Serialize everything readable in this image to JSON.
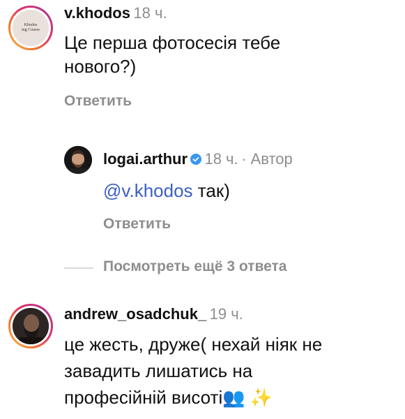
{
  "comments": [
    {
      "username": "v.khodos",
      "time": "18 ч.",
      "text": "Це перша фотосесія тебе нового?)",
      "reply_label": "Ответить",
      "avatar_text_1": "Khodos",
      "avatar_text_2": "ing Course"
    },
    {
      "username": "logai.arthur",
      "time": "18 ч.",
      "author_label": "· Автор",
      "mention": "@v.khodos",
      "text": " так)",
      "reply_label": "Ответить"
    },
    {
      "username": "andrew_osadchuk_",
      "time": "19 ч.",
      "text_line_1": "це жесть, друже( нехай ніяк не",
      "text_line_2": "завадить лишатись на",
      "text_line_3": "професійній висоті",
      "emoji": "👥 ✨"
    }
  ],
  "view_more": "Посмотреть ещё 3 ответа",
  "colors": {
    "text": "#111111",
    "muted": "#8e8e8e",
    "mention": "#3b5fc4",
    "verified": "#3897f0"
  }
}
